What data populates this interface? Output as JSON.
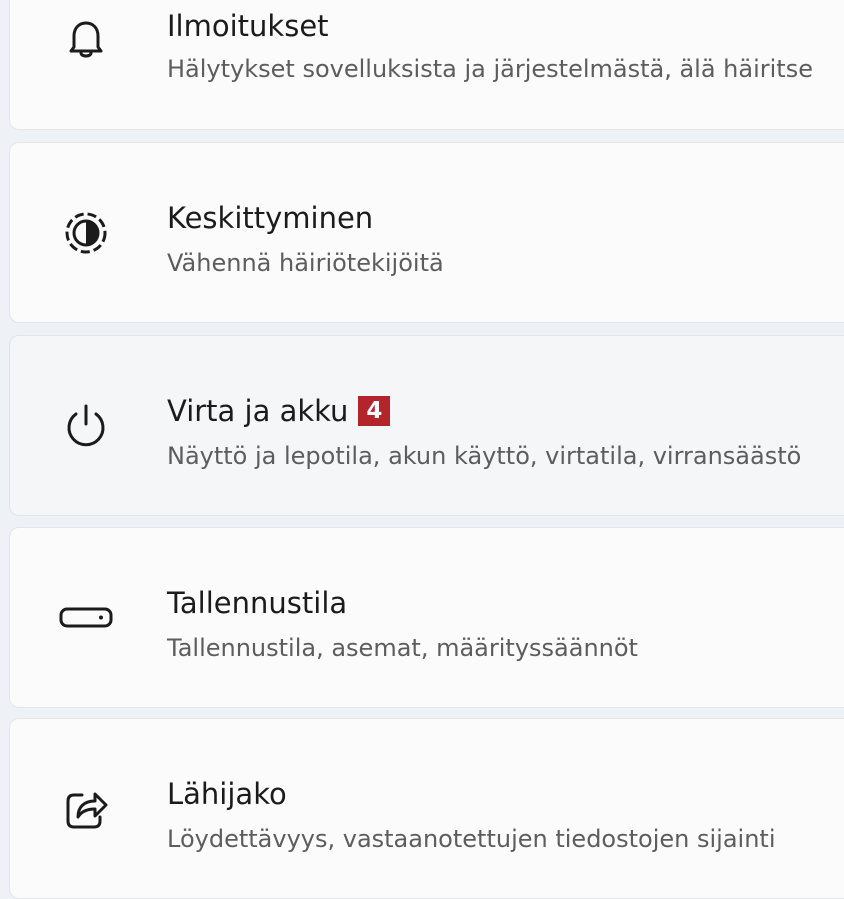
{
  "items": [
    {
      "title": "Ilmoitukset",
      "subtitle": "Hälytykset sovelluksista ja järjestelmästä, älä häiritse",
      "icon": "bell-icon"
    },
    {
      "title": "Keskittyminen",
      "subtitle": "Vähennä häiriötekijöitä",
      "icon": "focus-icon"
    },
    {
      "title": "Virta ja akku",
      "subtitle": "Näyttö ja lepotila, akun käyttö, virtatila, virransäästö",
      "icon": "power-icon",
      "badge": "4"
    },
    {
      "title": "Tallennustila",
      "subtitle": "Tallennustila, asemat, määrityssäännöt",
      "icon": "storage-drive-icon"
    },
    {
      "title": "Lähijako",
      "subtitle": "Löydettävyys, vastaanotettujen tiedostojen sijainti",
      "icon": "share-icon"
    }
  ],
  "colors": {
    "badge": "#b3252b",
    "card": "#fbfbfc",
    "background": "#eef1f5"
  }
}
